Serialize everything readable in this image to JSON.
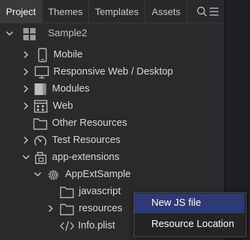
{
  "tabs": [
    {
      "label": "Project"
    },
    {
      "label": "Themes"
    },
    {
      "label": "Templates"
    },
    {
      "label": "Assets"
    }
  ],
  "tree": {
    "root": {
      "label": "Sample2",
      "icon": "grid-icon"
    },
    "items": [
      {
        "label": "Mobile",
        "icon": "phone-icon"
      },
      {
        "label": "Responsive Web / Desktop",
        "icon": "monitor-icon"
      },
      {
        "label": "Modules",
        "icon": "module-icon"
      },
      {
        "label": "Web",
        "icon": "web-icon"
      },
      {
        "label": "Other Resources",
        "icon": "folder-icon"
      },
      {
        "label": "Test Resources",
        "icon": "gauge-icon"
      },
      {
        "label": "app-extensions",
        "icon": "extension-icon"
      },
      {
        "label": "AppExtSample",
        "icon": "gear-icon"
      },
      {
        "label": "javascript",
        "icon": "folder-icon"
      },
      {
        "label": "resources",
        "icon": "folder-icon"
      },
      {
        "label": "Info.plist",
        "icon": "code-icon"
      }
    ]
  },
  "context_menu": {
    "items": [
      {
        "label": "New JS file"
      },
      {
        "label": "Resource Location"
      }
    ]
  }
}
